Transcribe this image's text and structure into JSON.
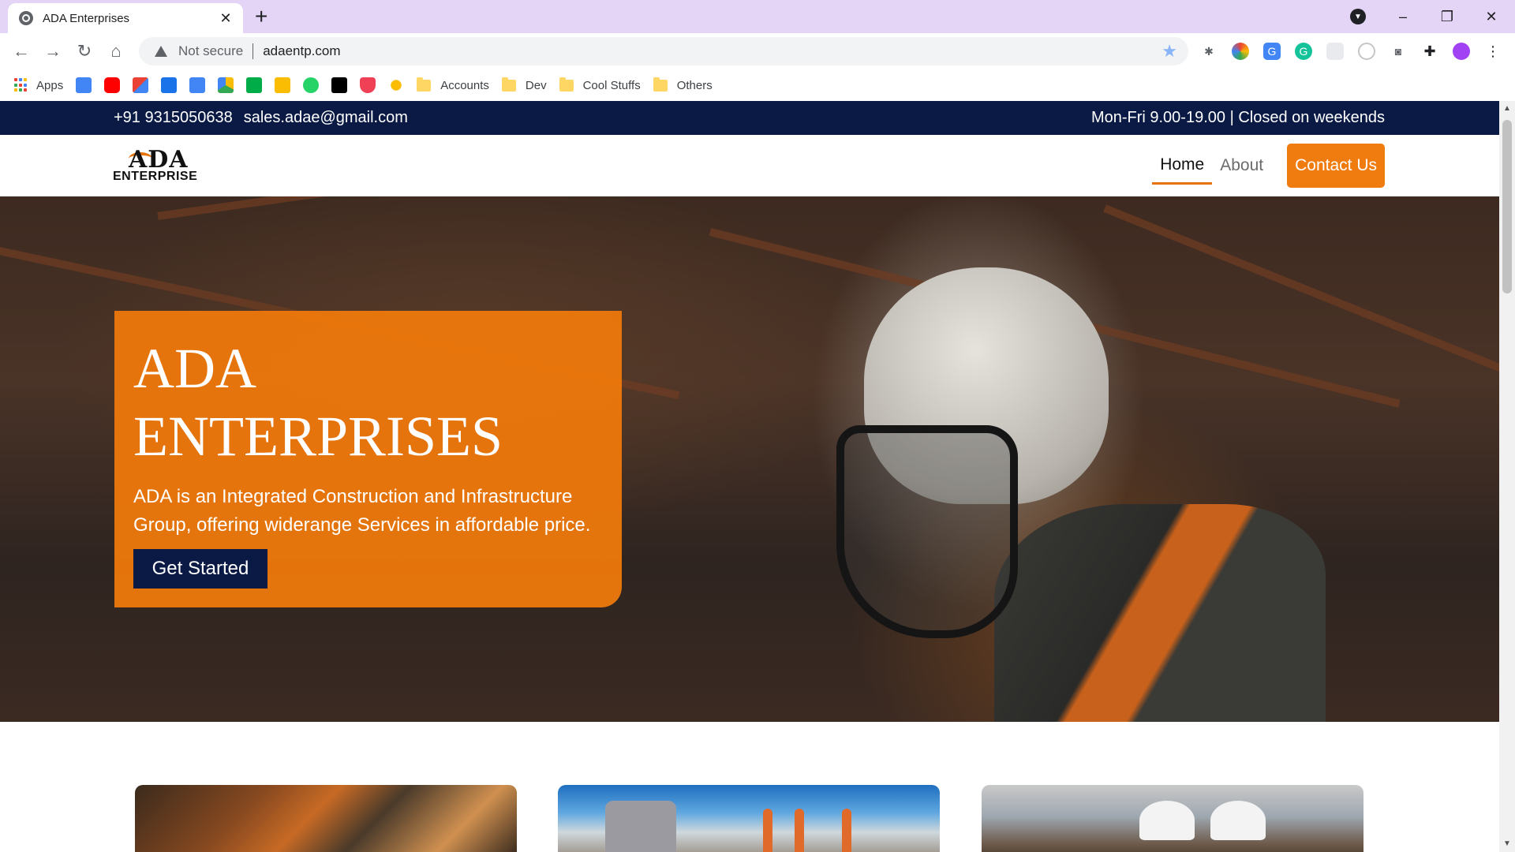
{
  "browser": {
    "tab_title": "ADA Enterprises",
    "new_tab_symbol": "+",
    "close_symbol": "✕",
    "address": {
      "security_label": "Not secure",
      "url": "adaentp.com"
    },
    "bookmarks": {
      "apps_label": "Apps",
      "folders": [
        "Accounts",
        "Dev",
        "Cool Stuffs",
        "Others"
      ],
      "icon_names": [
        "calendar-g-icon",
        "youtube-icon",
        "gmail-icon",
        "google-calendar-icon",
        "google-docs-icon",
        "google-drive-icon",
        "google-meet-icon",
        "keep-icon",
        "whatsapp-icon",
        "medium-icon",
        "pocket-icon",
        "weather-icon"
      ]
    },
    "window_controls": [
      "–",
      "❐",
      "✕"
    ]
  },
  "site": {
    "topbar": {
      "phone": "+91 9315050638",
      "email": "sales.adae@gmail.com",
      "hours": "Mon-Fri 9.00-19.00 | Closed on weekends"
    },
    "logo": {
      "mark": "ADA",
      "word": "ENTERPRISE"
    },
    "nav": {
      "home": "Home",
      "about": "About",
      "contact": "Contact Us"
    },
    "hero": {
      "title_line1": "ADA",
      "title_line2": "ENTERPRISES",
      "subtitle": "ADA is an Integrated Construction and Infrastructure Group, offering widerange Services in affordable price.",
      "cta": "Get Started"
    }
  },
  "colors": {
    "navy": "#0a1a45",
    "orange": "#f07c10",
    "tabstrip": "#e4d4f6"
  }
}
